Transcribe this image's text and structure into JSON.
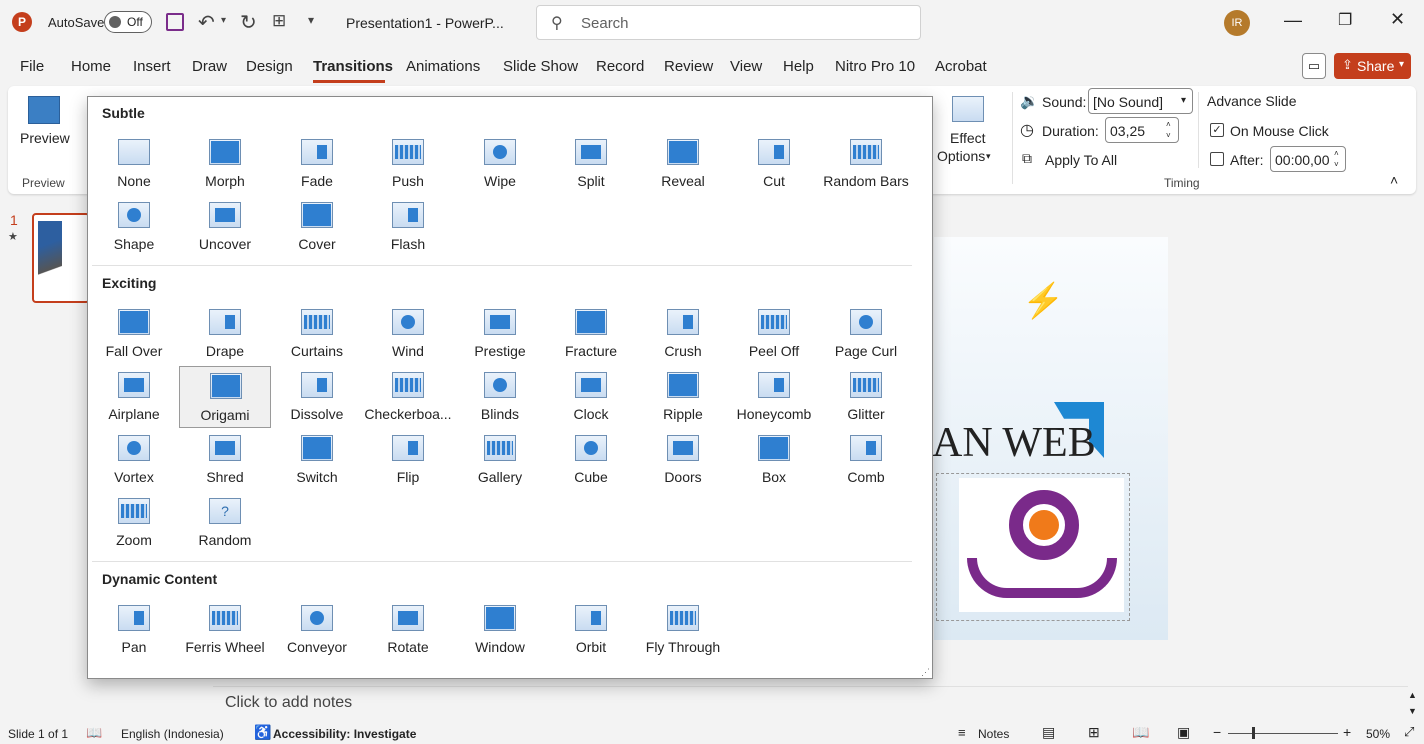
{
  "titlebar": {
    "app_icon": "powerpoint-icon",
    "autosave_label": "AutoSave",
    "autosave_state": "Off",
    "doc_title": "Presentation1  -  PowerP...",
    "search_placeholder": "Search",
    "avatar_initials": "IR"
  },
  "menu": {
    "items": [
      "File",
      "Home",
      "Insert",
      "Draw",
      "Design",
      "Transitions",
      "Animations",
      "Slide Show",
      "Record",
      "Review",
      "View",
      "Help",
      "Nitro Pro 10",
      "Acrobat"
    ],
    "active": "Transitions",
    "share_label": "Share"
  },
  "ribbon": {
    "preview_label": "Preview",
    "preview_group": "Preview",
    "effect_options_line1": "Effect",
    "effect_options_line2": "Options",
    "sound_label": "Sound:",
    "sound_value": "[No Sound]",
    "duration_label": "Duration:",
    "duration_value": "03,25",
    "apply_all_label": "Apply To All",
    "advance_title": "Advance Slide",
    "on_mouse_click_label": "On Mouse Click",
    "on_mouse_click_checked": true,
    "after_label": "After:",
    "after_value": "00:00,00",
    "after_checked": false,
    "timing_group": "Timing"
  },
  "gallery": {
    "sections": [
      {
        "title": "Subtle",
        "items": [
          "None",
          "Morph",
          "Fade",
          "Push",
          "Wipe",
          "Split",
          "Reveal",
          "Cut",
          "Random Bars",
          "Shape",
          "Uncover",
          "Cover",
          "Flash"
        ]
      },
      {
        "title": "Exciting",
        "items": [
          "Fall Over",
          "Drape",
          "Curtains",
          "Wind",
          "Prestige",
          "Fracture",
          "Crush",
          "Peel Off",
          "Page Curl",
          "Airplane",
          "Origami",
          "Dissolve",
          "Checkerboa...",
          "Blinds",
          "Clock",
          "Ripple",
          "Honeycomb",
          "Glitter",
          "Vortex",
          "Shred",
          "Switch",
          "Flip",
          "Gallery",
          "Cube",
          "Doors",
          "Box",
          "Comb",
          "Zoom",
          "Random"
        ]
      },
      {
        "title": "Dynamic Content",
        "items": [
          "Pan",
          "Ferris Wheel",
          "Conveyor",
          "Rotate",
          "Window",
          "Orbit",
          "Fly Through"
        ]
      }
    ],
    "selected": "Origami"
  },
  "slide_panel": {
    "number": "1"
  },
  "slide": {
    "title_fragment": "AN WEB"
  },
  "notes_placeholder": "Click to add notes",
  "status": {
    "slide_info": "Slide 1 of 1",
    "language": "English (Indonesia)",
    "accessibility": "Accessibility: Investigate",
    "notes_label": "Notes",
    "zoom": "50%"
  },
  "colors": {
    "accent": "#c43e1c",
    "icon_blue": "#2f7fd0"
  }
}
